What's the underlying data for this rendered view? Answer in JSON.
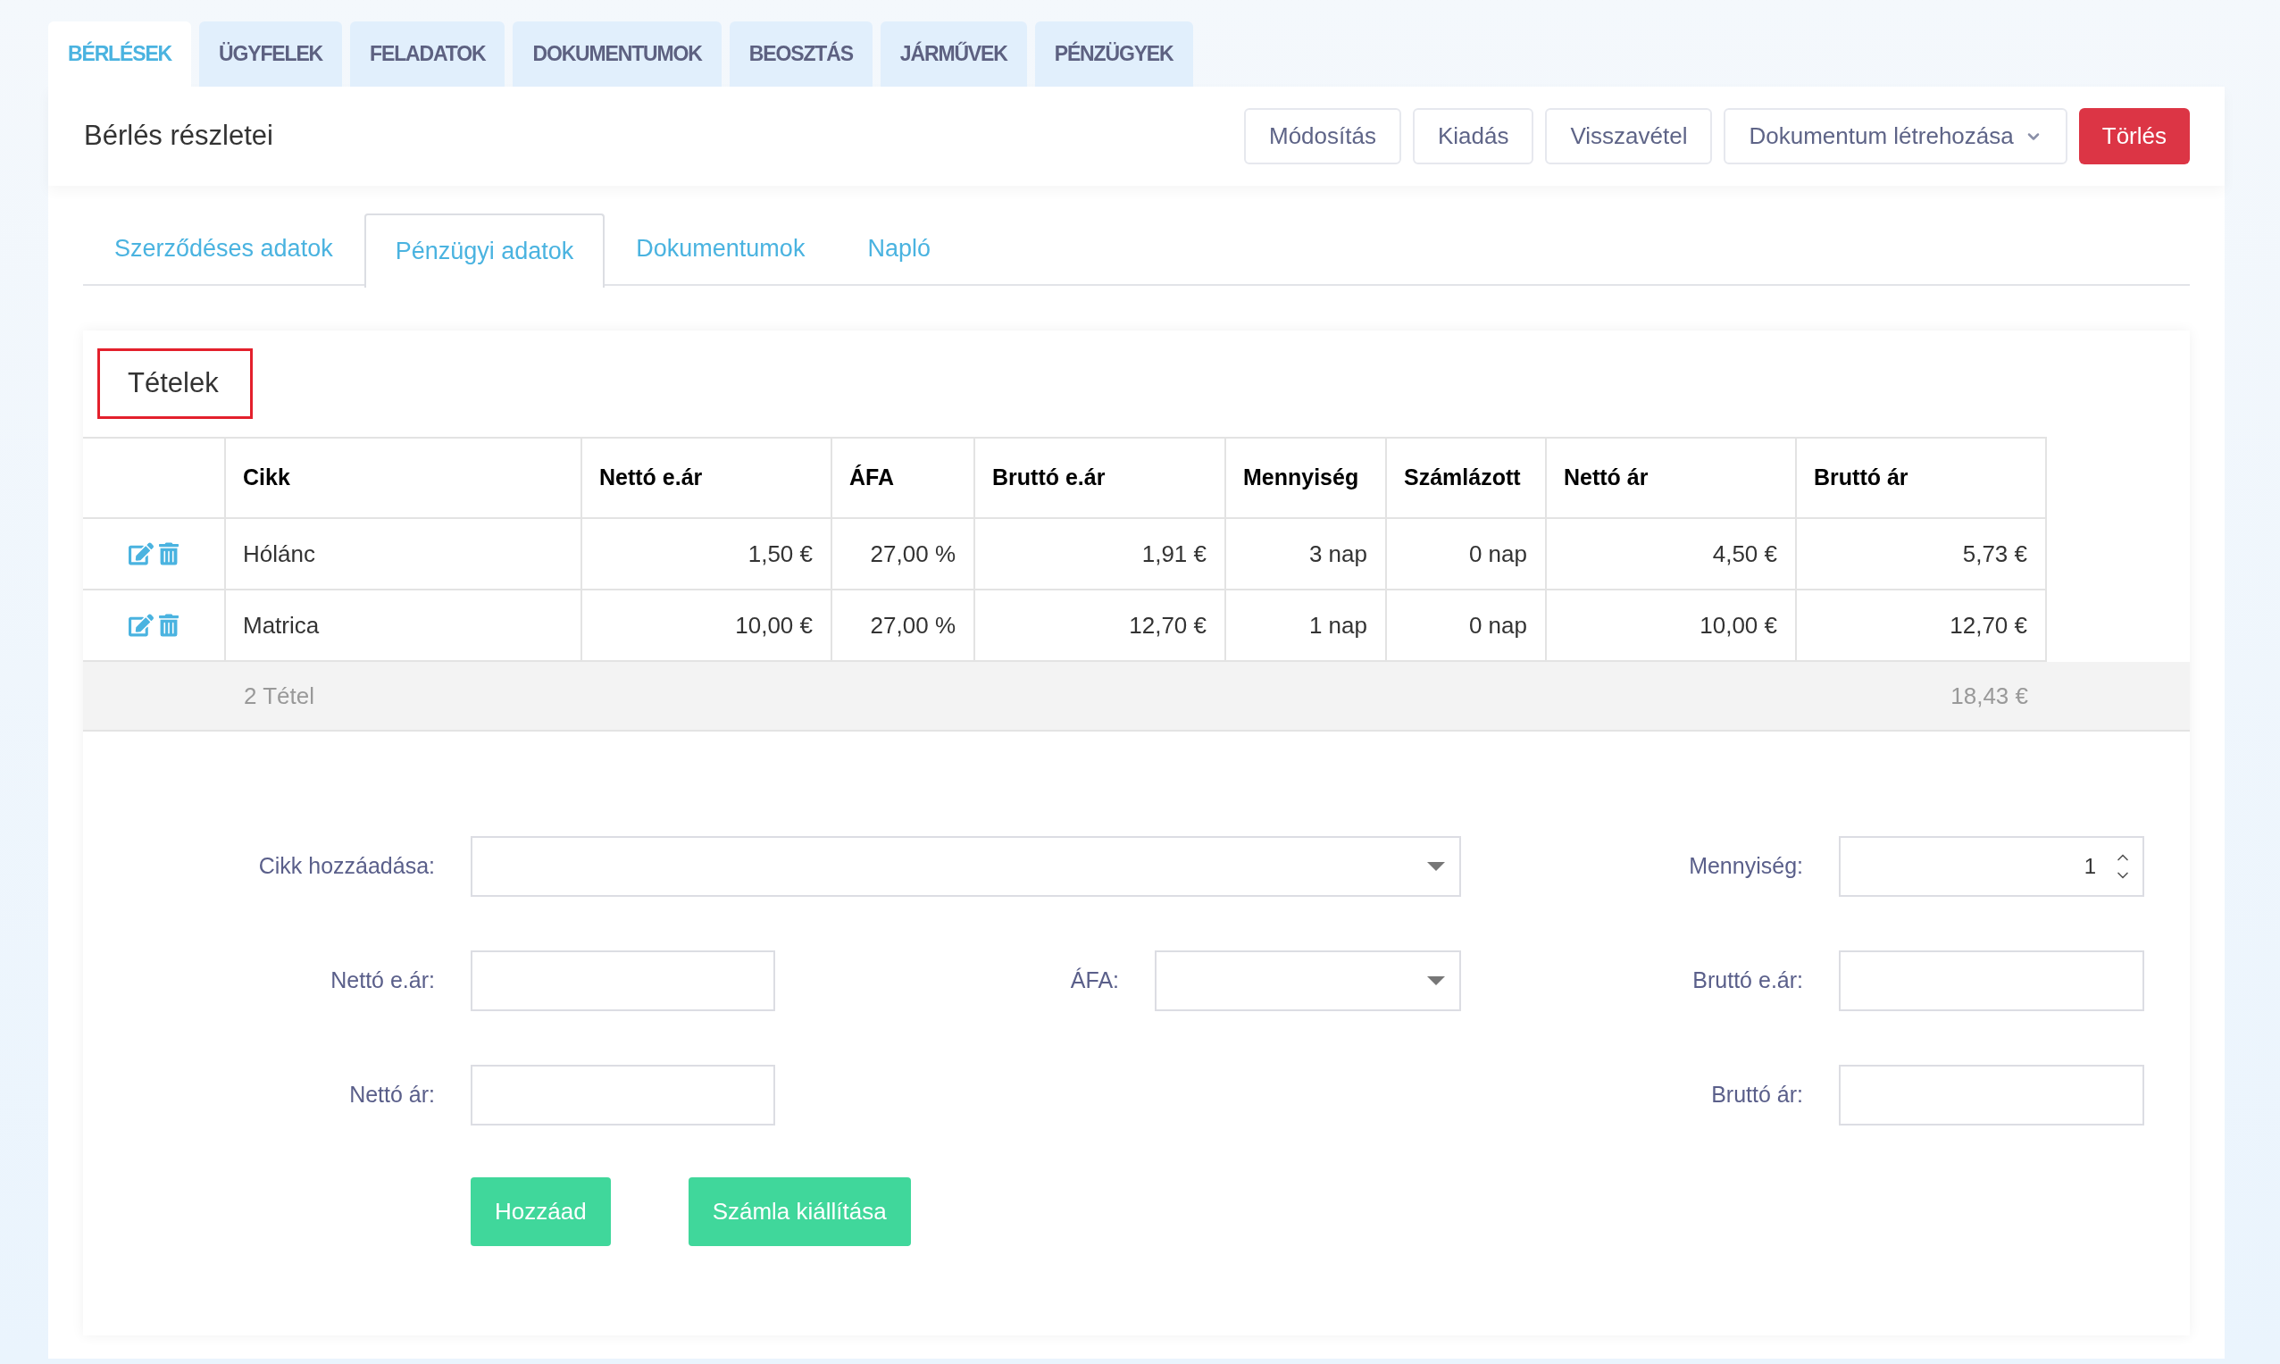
{
  "main_tabs": [
    {
      "label": "BÉRLÉSEK",
      "selected": true
    },
    {
      "label": "ÜGYFELEK",
      "selected": false
    },
    {
      "label": "FELADATOK",
      "selected": false
    },
    {
      "label": "DOKUMENTUMOK",
      "selected": false
    },
    {
      "label": "BEOSZTÁS",
      "selected": false
    },
    {
      "label": "JÁRMŰVEK",
      "selected": false
    },
    {
      "label": "PÉNZÜGYEK",
      "selected": false
    }
  ],
  "header": {
    "title": "Bérlés részletei",
    "buttons": [
      {
        "label": "Módosítás",
        "kind": "default"
      },
      {
        "label": "Kiadás",
        "kind": "default"
      },
      {
        "label": "Visszavétel",
        "kind": "default"
      },
      {
        "label": "Dokumentum létrehozása",
        "kind": "dropdown"
      },
      {
        "label": "Törlés",
        "kind": "danger"
      }
    ]
  },
  "sub_tabs": [
    {
      "label": "Szerződéses adatok",
      "selected": false
    },
    {
      "label": "Pénzügyi adatok",
      "selected": true
    },
    {
      "label": "Dokumentumok",
      "selected": false
    },
    {
      "label": "Napló",
      "selected": false
    }
  ],
  "items_panel": {
    "title": "Tételek",
    "columns": [
      "Cikk",
      "Nettó e.ár",
      "ÁFA",
      "Bruttó e.ár",
      "Mennyiség",
      "Számlázott",
      "Nettó ár",
      "Bruttó ár"
    ],
    "rows": [
      {
        "cells": [
          "Hólánc",
          "1,50 €",
          "27,00 %",
          "1,91 €",
          "3 nap",
          "0 nap",
          "4,50 €",
          "5,73 €"
        ]
      },
      {
        "cells": [
          "Matrica",
          "10,00 €",
          "27,00 %",
          "12,70 €",
          "1 nap",
          "0 nap",
          "10,00 €",
          "12,70 €"
        ]
      }
    ],
    "footer": {
      "count": "2 Tétel",
      "total": "18,43 €"
    }
  },
  "form": {
    "fields": [
      {
        "label": "Cikk hozzáadása:",
        "kind": "select"
      },
      {
        "label": "Mennyiség:",
        "kind": "number",
        "value": "1"
      },
      {
        "label": "Nettó e.ár:",
        "kind": "text"
      },
      {
        "label": "ÁFA:",
        "kind": "select"
      },
      {
        "label": "Bruttó e.ár:",
        "kind": "text"
      },
      {
        "label": "Nettó ár:",
        "kind": "text"
      },
      {
        "label": "Bruttó ár:",
        "kind": "text"
      }
    ],
    "buttons": [
      "Hozzáad",
      "Számla kiállítása"
    ]
  }
}
